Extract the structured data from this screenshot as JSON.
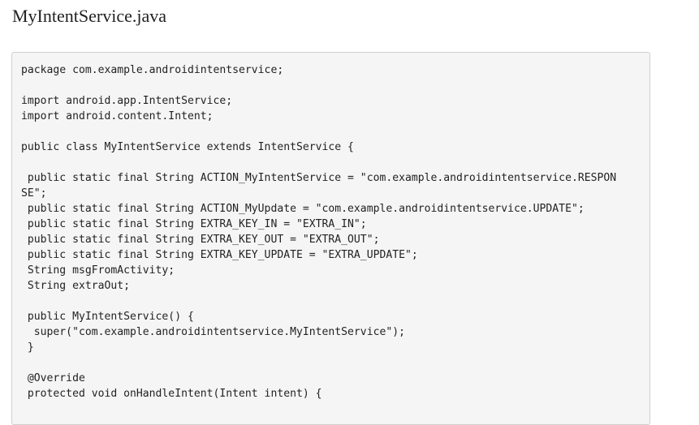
{
  "page": {
    "title": "MyIntentService.java"
  },
  "code": {
    "lines": [
      "package com.example.androidintentservice;",
      "",
      "import android.app.IntentService;",
      "import android.content.Intent;",
      "",
      "public class MyIntentService extends IntentService {",
      "",
      " public static final String ACTION_MyIntentService = \"com.example.androidintentservice.RESPON",
      "SE\";",
      " public static final String ACTION_MyUpdate = \"com.example.androidintentservice.UPDATE\";",
      " public static final String EXTRA_KEY_IN = \"EXTRA_IN\";",
      " public static final String EXTRA_KEY_OUT = \"EXTRA_OUT\";",
      " public static final String EXTRA_KEY_UPDATE = \"EXTRA_UPDATE\";",
      " String msgFromActivity;",
      " String extraOut;",
      "",
      " public MyIntentService() {",
      "  super(\"com.example.androidintentservice.MyIntentService\");",
      " }",
      "",
      " @Override",
      " protected void onHandleIntent(Intent intent) {"
    ]
  }
}
